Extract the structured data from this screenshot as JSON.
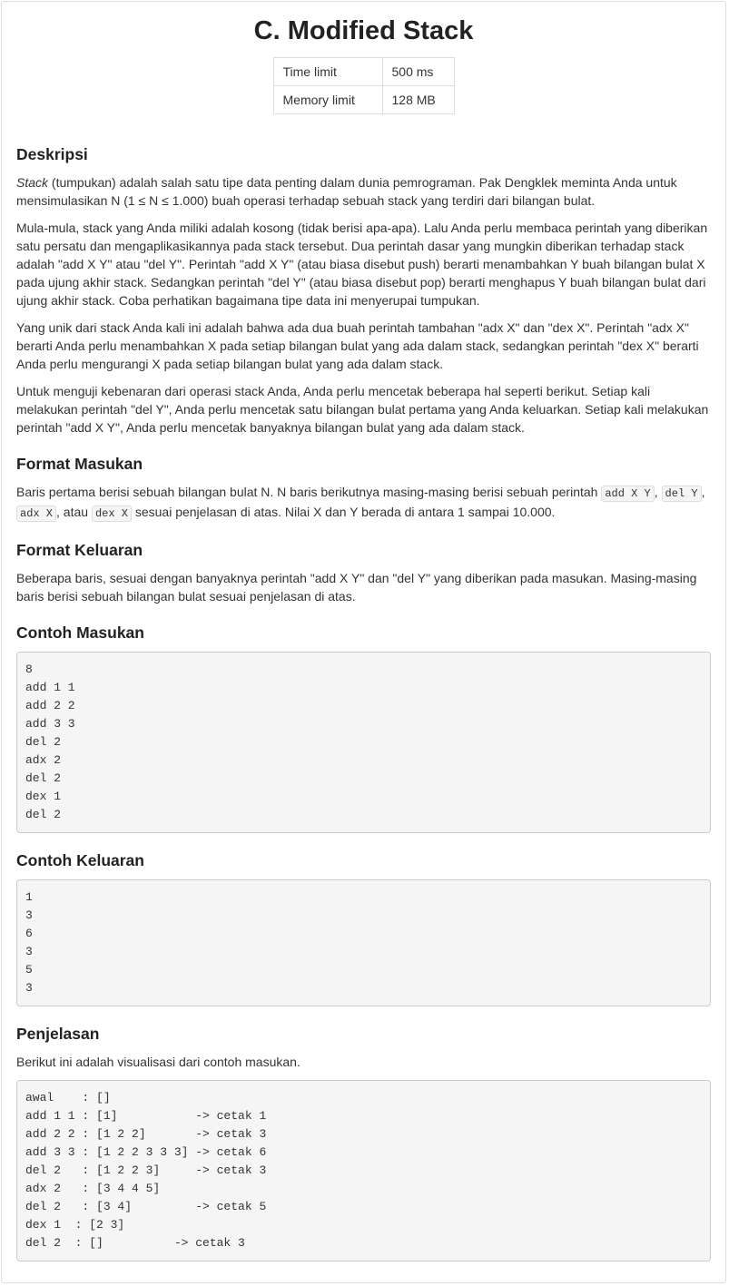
{
  "title": "C. Modified Stack",
  "limits": [
    {
      "label": "Time limit",
      "value": "500 ms"
    },
    {
      "label": "Memory limit",
      "value": "128 MB"
    }
  ],
  "deskripsi": {
    "heading": "Deskripsi",
    "p1_em": "Stack",
    "p1": " (tumpukan) adalah salah satu tipe data penting dalam dunia pemrograman. Pak Dengklek meminta Anda untuk mensimulasikan N (1 ≤ N ≤ 1.000) buah operasi terhadap sebuah stack yang terdiri dari bilangan bulat.",
    "p2": "Mula-mula, stack yang Anda miliki adalah kosong (tidak berisi apa-apa). Lalu Anda perlu membaca perintah yang diberikan satu persatu dan mengaplikasikannya pada stack tersebut. Dua perintah dasar yang mungkin diberikan terhadap stack adalah \"add X Y\" atau \"del Y\". Perintah \"add X Y\" (atau biasa disebut push) berarti menambahkan Y buah bilangan bulat X pada ujung akhir stack. Sedangkan perintah \"del Y\" (atau biasa disebut pop) berarti menghapus Y buah bilangan bulat dari ujung akhir stack. Coba perhatikan bagaimana tipe data ini menyerupai tumpukan.",
    "p3": "Yang unik dari stack Anda kali ini adalah bahwa ada dua buah perintah tambahan \"adx X\" dan \"dex X\". Perintah \"adx X\" berarti Anda perlu menambahkan X pada setiap bilangan bulat yang ada dalam stack, sedangkan perintah \"dex X\" berarti Anda perlu mengurangi X pada setiap bilangan bulat yang ada dalam stack.",
    "p4": "Untuk menguji kebenaran dari operasi stack Anda, Anda perlu mencetak beberapa hal seperti berikut. Setiap kali melakukan perintah \"del Y\", Anda perlu mencetak satu bilangan bulat pertama yang Anda keluarkan. Setiap kali melakukan perintah \"add X Y\", Anda perlu mencetak banyaknya bilangan bulat yang ada dalam stack."
  },
  "format_masukan": {
    "heading": "Format Masukan",
    "t1": "Baris pertama berisi sebuah bilangan bulat N. N baris berikutnya masing-masing berisi sebuah perintah ",
    "c1": "add X Y",
    "t2": ", ",
    "c2": "del Y",
    "t3": ", ",
    "c3": "adx X",
    "t4": ", atau ",
    "c4": "dex X",
    "t5": " sesuai penjelasan di atas. Nilai X dan Y berada di antara 1 sampai 10.000."
  },
  "format_keluaran": {
    "heading": "Format Keluaran",
    "text": "Beberapa baris, sesuai dengan banyaknya perintah \"add X Y\" dan \"del Y\" yang diberikan pada masukan. Masing-masing baris berisi sebuah bilangan bulat sesuai penjelasan di atas."
  },
  "contoh_masukan": {
    "heading": "Contoh Masukan",
    "code": "8\nadd 1 1\nadd 2 2\nadd 3 3\ndel 2\nadx 2\ndel 2\ndex 1\ndel 2"
  },
  "contoh_keluaran": {
    "heading": "Contoh Keluaran",
    "code": "1\n3\n6\n3\n5\n3"
  },
  "penjelasan": {
    "heading": "Penjelasan",
    "text": "Berikut ini adalah visualisasi dari contoh masukan.",
    "code": "awal    : []\nadd 1 1 : [1]           -> cetak 1\nadd 2 2 : [1 2 2]       -> cetak 3\nadd 3 3 : [1 2 2 3 3 3] -> cetak 6\ndel 2   : [1 2 2 3]     -> cetak 3\nadx 2   : [3 4 4 5]\ndel 2   : [3 4]         -> cetak 5\ndex 1  : [2 3]\ndel 2  : []          -> cetak 3"
  }
}
